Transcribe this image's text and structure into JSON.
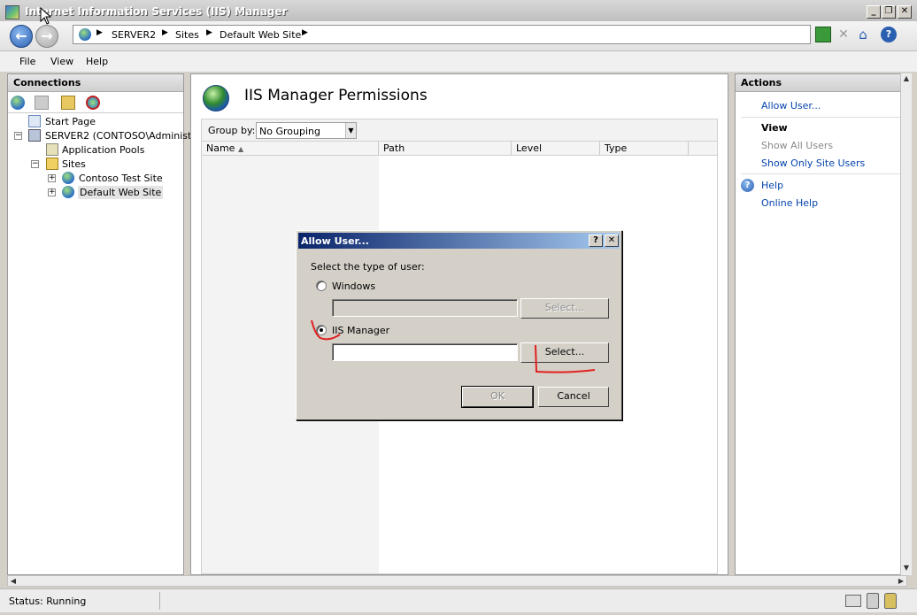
{
  "window": {
    "title": "Internet Information Services (IIS) Manager",
    "controls": [
      "_",
      "❐",
      "✕"
    ]
  },
  "address": {
    "segments": [
      "SERVER2",
      "Sites",
      "Default Web Site"
    ]
  },
  "menu": [
    "File",
    "View",
    "Help"
  ],
  "connections": {
    "title": "Connections",
    "tree": {
      "start_page": "Start Page",
      "server": "SERVER2 (CONTOSO\\Administra",
      "app_pools": "Application Pools",
      "sites": "Sites",
      "site1": "Contoso Test Site",
      "site2": "Default Web Site"
    }
  },
  "center": {
    "title": "IIS Manager Permissions",
    "group_by_label": "Group by:",
    "group_by_value": "No Grouping",
    "columns": [
      "Name",
      "Path",
      "Level",
      "Type"
    ]
  },
  "actions": {
    "title": "Actions",
    "allow_user": "Allow User...",
    "view_title": "View",
    "show_all": "Show All Users",
    "show_site": "Show Only Site Users",
    "help": "Help",
    "online_help": "Online Help"
  },
  "dialog": {
    "title": "Allow User...",
    "prompt": "Select the type of user:",
    "option_windows": "Windows",
    "option_iis": "IIS Manager",
    "select_label": "Select...",
    "ok": "OK",
    "cancel": "Cancel",
    "selected": "IIS Manager"
  },
  "status": {
    "text": "Status: Running"
  }
}
